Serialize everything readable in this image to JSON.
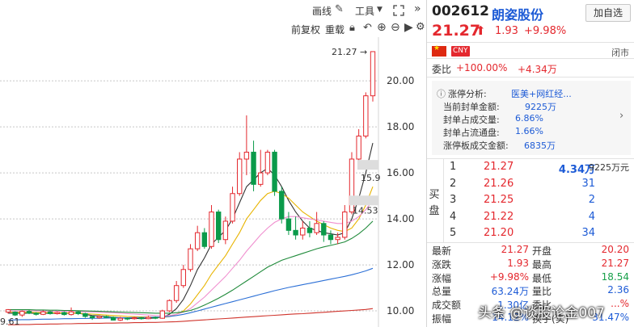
{
  "toolbar": {
    "draw_line_label": "画线",
    "tools_label": "工具",
    "pre_adjust_label": "前复权",
    "overlay_label": "重载"
  },
  "chart_data": {
    "type": "candlestick",
    "ylim": [
      9.3,
      21.9
    ],
    "y_ticks": [
      20.0,
      18.0,
      16.0,
      14.0,
      12.0,
      10.0
    ],
    "tick_labels": [
      "20.00",
      "18.00",
      "16.00",
      "14.00",
      "12.00",
      "10.00"
    ],
    "annotations": {
      "high": "21.27",
      "low": "9.61",
      "ma_a": "15.9",
      "ma_b": "14.53"
    },
    "candles": [
      [
        9.95,
        10.05,
        9.88,
        10.08
      ],
      [
        9.95,
        9.82,
        9.78,
        9.98
      ],
      [
        9.82,
        9.98,
        9.74,
        10.02
      ],
      [
        9.98,
        9.9,
        9.86,
        10.05
      ],
      [
        9.9,
        9.85,
        9.8,
        9.95
      ],
      [
        9.85,
        9.96,
        9.82,
        10.02
      ],
      [
        9.96,
        9.88,
        9.84,
        10.0
      ],
      [
        9.88,
        9.93,
        9.84,
        9.98
      ],
      [
        9.93,
        9.84,
        9.8,
        9.98
      ],
      [
        9.84,
        9.96,
        9.8,
        10.15
      ],
      [
        9.96,
        9.88,
        9.82,
        10.0
      ],
      [
        9.88,
        9.76,
        9.7,
        9.92
      ],
      [
        9.76,
        9.7,
        9.61,
        9.8
      ],
      [
        9.7,
        9.76,
        9.66,
        9.8
      ],
      [
        9.76,
        9.72,
        9.68,
        9.8
      ],
      [
        9.72,
        9.6,
        9.58,
        9.76
      ],
      [
        9.6,
        9.68,
        9.56,
        9.74
      ],
      [
        9.68,
        9.66,
        9.6,
        9.72
      ],
      [
        9.66,
        9.7,
        9.62,
        9.74
      ],
      [
        9.7,
        9.66,
        9.62,
        9.74
      ],
      [
        9.66,
        9.72,
        9.64,
        9.78
      ],
      [
        9.72,
        9.68,
        9.64,
        9.76
      ],
      [
        9.68,
        10.0,
        9.66,
        10.05
      ],
      [
        10.0,
        10.45,
        9.95,
        10.5
      ],
      [
        10.45,
        11.1,
        10.35,
        11.3
      ],
      [
        11.1,
        11.8,
        11.0,
        12.0
      ],
      [
        11.8,
        12.7,
        11.7,
        12.9
      ],
      [
        12.7,
        13.4,
        12.6,
        13.7
      ],
      [
        13.4,
        12.8,
        12.7,
        13.6
      ],
      [
        12.8,
        14.3,
        12.7,
        14.6
      ],
      [
        14.3,
        13.1,
        12.95,
        14.4
      ],
      [
        13.1,
        13.9,
        12.9,
        14.1
      ],
      [
        13.9,
        15.1,
        13.8,
        15.4
      ],
      [
        15.1,
        16.6,
        15.0,
        16.9
      ],
      [
        16.6,
        16.9,
        15.9,
        18.5
      ],
      [
        16.9,
        15.5,
        15.2,
        17.4
      ],
      [
        15.5,
        16.0,
        15.4,
        17.0
      ],
      [
        16.0,
        16.9,
        15.9,
        17.0
      ],
      [
        16.9,
        15.2,
        15.0,
        17.0
      ],
      [
        15.2,
        14.0,
        13.8,
        15.4
      ],
      [
        14.0,
        13.5,
        13.3,
        14.3
      ],
      [
        13.5,
        13.3,
        13.1,
        14.1
      ],
      [
        13.3,
        13.6,
        13.1,
        13.9
      ],
      [
        13.6,
        13.4,
        13.2,
        13.9
      ],
      [
        13.4,
        13.8,
        13.3,
        14.3
      ],
      [
        13.8,
        13.3,
        13.0,
        13.9
      ],
      [
        13.3,
        13.1,
        12.9,
        13.5
      ],
      [
        13.1,
        13.2,
        12.9,
        13.4
      ],
      [
        13.2,
        14.3,
        13.1,
        14.6
      ],
      [
        14.3,
        16.6,
        14.2,
        16.9
      ],
      [
        16.6,
        17.6,
        16.4,
        17.9
      ],
      [
        17.6,
        19.35,
        17.5,
        19.5
      ],
      [
        19.35,
        21.27,
        19.1,
        21.27
      ]
    ],
    "ma_series": [
      {
        "color": "#333333",
        "values": [
          9.9,
          9.9,
          9.9,
          9.9,
          9.9,
          9.9,
          9.9,
          9.9,
          9.9,
          9.9,
          9.9,
          9.85,
          9.8,
          9.78,
          9.75,
          9.72,
          9.7,
          9.68,
          9.67,
          9.67,
          9.68,
          9.69,
          9.73,
          9.85,
          10.1,
          10.5,
          11.1,
          11.8,
          12.3,
          12.9,
          13.2,
          13.5,
          14.0,
          14.7,
          15.4,
          15.7,
          16.0,
          16.2,
          15.9,
          15.4,
          14.8,
          14.3,
          13.9,
          13.6,
          13.5,
          13.4,
          13.35,
          13.3,
          13.4,
          14.0,
          14.9,
          16.0,
          17.3
        ]
      },
      {
        "color": "#e8b400",
        "values": [
          9.95,
          9.95,
          9.94,
          9.94,
          9.93,
          9.93,
          9.92,
          9.92,
          9.91,
          9.91,
          9.9,
          9.88,
          9.86,
          9.84,
          9.82,
          9.8,
          9.78,
          9.76,
          9.75,
          9.74,
          9.73,
          9.72,
          9.72,
          9.75,
          9.85,
          10.0,
          10.3,
          10.7,
          11.1,
          11.6,
          12.0,
          12.4,
          12.9,
          13.4,
          14.0,
          14.4,
          14.8,
          15.1,
          15.2,
          15.1,
          14.9,
          14.6,
          14.3,
          14.1,
          13.9,
          13.75,
          13.6,
          13.5,
          13.45,
          13.6,
          14.0,
          14.6,
          15.4
        ]
      },
      {
        "color": "#f08fcf",
        "values": [
          10.0,
          10.0,
          10.0,
          10.0,
          10.0,
          9.99,
          9.99,
          9.98,
          9.98,
          9.97,
          9.97,
          9.96,
          9.95,
          9.94,
          9.93,
          9.92,
          9.9,
          9.88,
          9.86,
          9.84,
          9.82,
          9.8,
          9.79,
          9.8,
          9.85,
          9.95,
          10.1,
          10.35,
          10.6,
          10.9,
          11.2,
          11.5,
          11.85,
          12.2,
          12.6,
          12.95,
          13.3,
          13.6,
          13.85,
          14.0,
          14.1,
          14.1,
          14.05,
          14.0,
          13.95,
          13.9,
          13.85,
          13.8,
          13.8,
          13.9,
          14.1,
          14.4,
          14.8
        ]
      },
      {
        "color": "#1f8a3a",
        "values": [
          10.05,
          10.05,
          10.05,
          10.05,
          10.04,
          10.04,
          10.03,
          10.03,
          10.02,
          10.02,
          10.01,
          10.0,
          9.99,
          9.98,
          9.97,
          9.96,
          9.95,
          9.94,
          9.93,
          9.92,
          9.91,
          9.9,
          9.9,
          9.9,
          9.92,
          9.96,
          10.02,
          10.12,
          10.25,
          10.4,
          10.55,
          10.72,
          10.9,
          11.1,
          11.3,
          11.5,
          11.7,
          11.9,
          12.05,
          12.2,
          12.3,
          12.4,
          12.5,
          12.6,
          12.7,
          12.78,
          12.85,
          12.92,
          13.0,
          13.15,
          13.35,
          13.6,
          13.9
        ]
      },
      {
        "color": "#2b6fd6",
        "values": [
          9.6,
          9.61,
          9.62,
          9.62,
          9.63,
          9.64,
          9.64,
          9.65,
          9.66,
          9.66,
          9.67,
          9.67,
          9.68,
          9.68,
          9.69,
          9.69,
          9.7,
          9.7,
          9.71,
          9.71,
          9.72,
          9.73,
          9.74,
          9.76,
          9.8,
          9.85,
          9.92,
          10.0,
          10.08,
          10.16,
          10.24,
          10.32,
          10.4,
          10.48,
          10.56,
          10.64,
          10.72,
          10.8,
          10.88,
          10.95,
          11.02,
          11.08,
          11.14,
          11.2,
          11.26,
          11.32,
          11.38,
          11.44,
          11.5,
          11.57,
          11.65,
          11.74,
          11.85
        ]
      },
      {
        "color": "#d0342c",
        "values": [
          9.4,
          9.4,
          9.41,
          9.41,
          9.42,
          9.42,
          9.43,
          9.43,
          9.44,
          9.44,
          9.45,
          9.45,
          9.46,
          9.46,
          9.47,
          9.47,
          9.48,
          9.48,
          9.49,
          9.49,
          9.5,
          9.5,
          9.51,
          9.52,
          9.53,
          9.55,
          9.57,
          9.59,
          9.61,
          9.63,
          9.65,
          9.67,
          9.69,
          9.71,
          9.73,
          9.75,
          9.77,
          9.79,
          9.81,
          9.83,
          9.85,
          9.87,
          9.88,
          9.9,
          9.92,
          9.94,
          9.96,
          9.98,
          10.0,
          10.02,
          10.04,
          10.06,
          10.1
        ]
      }
    ]
  },
  "quote": {
    "code": "002612",
    "name": "朗姿股份",
    "add_label": "加自选",
    "price": "21.27",
    "change": "1.93",
    "change_pct": "+9.98%",
    "currency": "CNY",
    "market_status": "闭市",
    "wb_label": "委比",
    "wb_pct": "+100.00%",
    "wb_diff": "+4.34万"
  },
  "limit_info": {
    "title": "涨停分析:",
    "concept": "医美+网红经...",
    "rows": [
      {
        "label": "当前封单金额:",
        "value": "9225万"
      },
      {
        "label": "封单占成交量:",
        "value": "6.86%"
      },
      {
        "label": "封单占流通盘:",
        "value": "1.66%"
      },
      {
        "label": "涨停板成交金额:",
        "value": "6835万"
      }
    ]
  },
  "orderbook": {
    "side_label": "买盘",
    "bids": [
      {
        "level": "1",
        "price": "21.27",
        "vol": "4.34万",
        "amount": "9225万元"
      },
      {
        "level": "2",
        "price": "21.26",
        "vol": "31",
        "amount": ""
      },
      {
        "level": "3",
        "price": "21.25",
        "vol": "2",
        "amount": ""
      },
      {
        "level": "4",
        "price": "21.22",
        "vol": "4",
        "amount": ""
      },
      {
        "level": "5",
        "price": "21.20",
        "vol": "34",
        "amount": ""
      }
    ]
  },
  "stats": [
    {
      "l1": "最新",
      "v1": "21.27",
      "c1": "red",
      "l2": "开盘",
      "v2": "20.20",
      "c2": "red"
    },
    {
      "l1": "涨跌",
      "v1": "1.93",
      "c1": "red",
      "l2": "最高",
      "v2": "21.27",
      "c2": "red"
    },
    {
      "l1": "涨幅",
      "v1": "+9.98%",
      "c1": "red",
      "l2": "最低",
      "v2": "18.54",
      "c2": "green"
    },
    {
      "l1": "总量",
      "v1": "63.24万",
      "c1": "blue",
      "l2": "量比",
      "v2": "2.36",
      "c2": "blue"
    },
    {
      "l1": "成交额",
      "v1": "1.30亿",
      "c1": "blue",
      "l2": "委比",
      "v2": "...%",
      "c2": "red"
    },
    {
      "l1": "振幅",
      "v1": "14.12%",
      "c1": "blue",
      "l2": "换手(实)",
      "v2": "31.47%",
      "c2": "blue"
    }
  ],
  "watermark": "头条 @谈股论金007",
  "colors": {
    "up": "#e4282e",
    "down": "#0a9a4a",
    "grid": "#c8c8c8",
    "blue": "#1d5bd6"
  }
}
